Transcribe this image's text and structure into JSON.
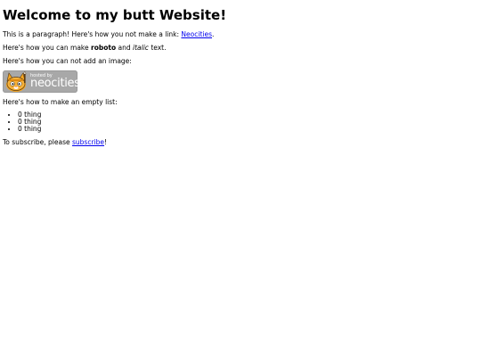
{
  "page": {
    "heading": "Welcome to my butt Website!",
    "p1_text": "This is a paragraph! Here's how you not make a link: ",
    "p1_link": "Neocities",
    "p1_end": ".",
    "p2_pre": "Here's how you can make ",
    "p2_bold": "roboto",
    "p2_mid": " and ",
    "p2_italic": "italic",
    "p2_end": " text.",
    "p3_text": "Here's how you can not add an image:",
    "badge": {
      "small": "hosted by",
      "big": "neocities"
    },
    "p4_text": "Here's how to make an empty list:",
    "list": [
      "0 thing",
      "0 thing",
      "0 thing"
    ],
    "p5_pre": "To subscribe, please ",
    "p5_link": "subscribe",
    "p5_end": "!"
  },
  "colors": {
    "link": "#0000ee",
    "badge_bg": "#a8a8a8",
    "cat_orange": "#f5a623"
  }
}
